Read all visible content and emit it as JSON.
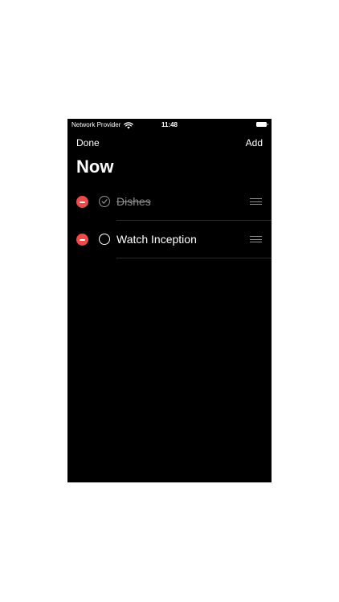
{
  "status_bar": {
    "carrier": "Network Provider",
    "time": "11:48",
    "wifi_icon": "wifi-icon",
    "battery_icon": "battery-full-icon"
  },
  "nav": {
    "done_label": "Done",
    "add_label": "Add"
  },
  "title": "Now",
  "tasks": [
    {
      "label": "Dishes",
      "completed": true
    },
    {
      "label": "Watch Inception",
      "completed": false
    }
  ],
  "colors": {
    "background": "#000000",
    "delete": "#ef4a4a",
    "completed_text": "#8e8e93",
    "text": "#ffffff"
  }
}
